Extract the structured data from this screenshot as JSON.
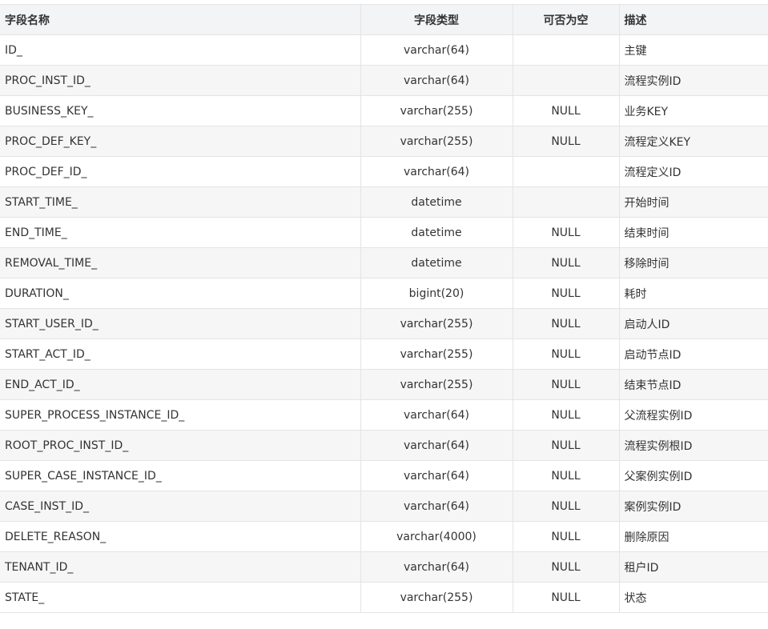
{
  "table": {
    "headers": [
      "字段名称",
      "字段类型",
      "可否为空",
      "描述"
    ],
    "rows": [
      [
        "ID_",
        "varchar(64)",
        "",
        "主键"
      ],
      [
        "PROC_INST_ID_",
        "varchar(64)",
        "",
        "流程实例ID"
      ],
      [
        "BUSINESS_KEY_",
        "varchar(255)",
        "NULL",
        "业务KEY"
      ],
      [
        "PROC_DEF_KEY_",
        "varchar(255)",
        "NULL",
        "流程定义KEY"
      ],
      [
        "PROC_DEF_ID_",
        "varchar(64)",
        "",
        "流程定义ID"
      ],
      [
        "START_TIME_",
        "datetime",
        "",
        "开始时间"
      ],
      [
        "END_TIME_",
        "datetime",
        "NULL",
        "结束时间"
      ],
      [
        "REMOVAL_TIME_",
        "datetime",
        "NULL",
        "移除时间"
      ],
      [
        "DURATION_",
        "bigint(20)",
        "NULL",
        "耗时"
      ],
      [
        "START_USER_ID_",
        "varchar(255)",
        "NULL",
        "启动人ID"
      ],
      [
        "START_ACT_ID_",
        "varchar(255)",
        "NULL",
        "启动节点ID"
      ],
      [
        "END_ACT_ID_",
        "varchar(255)",
        "NULL",
        "结束节点ID"
      ],
      [
        "SUPER_PROCESS_INSTANCE_ID_",
        "varchar(64)",
        "NULL",
        "父流程实例ID"
      ],
      [
        "ROOT_PROC_INST_ID_",
        "varchar(64)",
        "NULL",
        "流程实例根ID"
      ],
      [
        "SUPER_CASE_INSTANCE_ID_",
        "varchar(64)",
        "NULL",
        "父案例实例ID"
      ],
      [
        "CASE_INST_ID_",
        "varchar(64)",
        "NULL",
        "案例实例ID"
      ],
      [
        "DELETE_REASON_",
        "varchar(4000)",
        "NULL",
        "删除原因"
      ],
      [
        "TENANT_ID_",
        "varchar(64)",
        "NULL",
        "租户ID"
      ],
      [
        "STATE_",
        "varchar(255)",
        "NULL",
        "状态"
      ]
    ]
  }
}
